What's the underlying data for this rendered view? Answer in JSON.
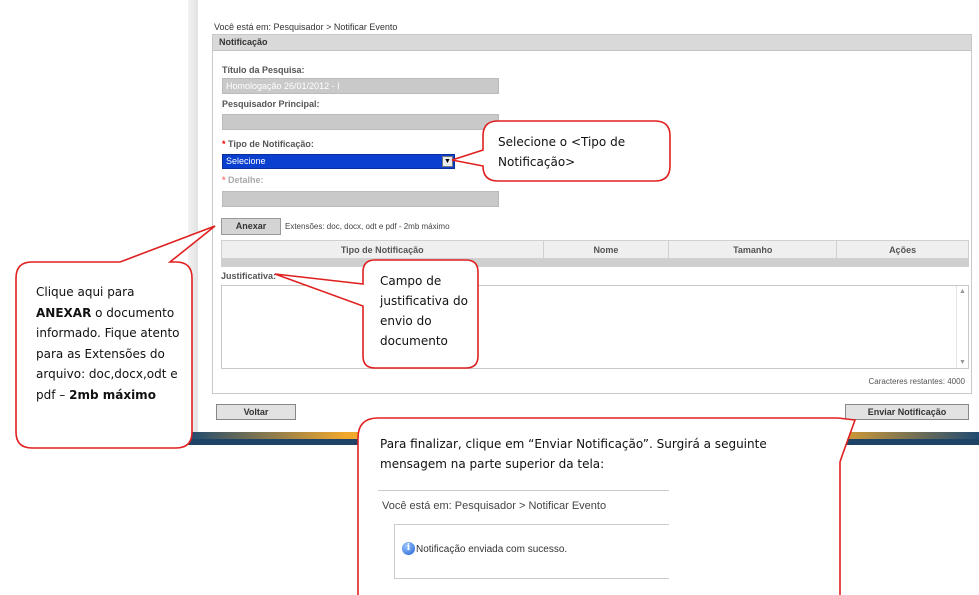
{
  "breadcrumb": "Você está em: Pesquisador > Notificar Evento",
  "panel": {
    "title": "Notificação",
    "titulo_label": "Título da Pesquisa:",
    "titulo_value": "Homologação 26/01/2012 - I",
    "pesquisador_label": "Pesquisador Principal:",
    "pesquisador_value": "",
    "tipo_label": "Tipo de Notificação:",
    "tipo_selected": "Selecione",
    "detalhe_label": "Detalhe:",
    "detalhe_value": "",
    "required_mark": "*"
  },
  "attach": {
    "button": "Anexar",
    "extensions": "Extensões: doc, docx, odt e pdf - 2mb máximo"
  },
  "table": {
    "columns": [
      "Tipo de Notificação",
      "Nome",
      "Tamanho",
      "Ações"
    ]
  },
  "justificativa": {
    "label": "Justificativa:",
    "value": "",
    "chars_left": "Caracteres restantes: 4000"
  },
  "buttons": {
    "voltar": "Voltar",
    "enviar": "Enviar Notificação"
  },
  "callouts": {
    "tipo": "Selecione o <Tipo de Notificação>",
    "anexar_pre": "Clique aqui para",
    "anexar_bold": "ANEXAR",
    "anexar_post": "o documento informado. Fique atento para as Extensões do arquivo: doc,docx,odt e pdf –",
    "anexar_bold2": "2mb máximo",
    "justificativa": "Campo de justificativa do envio do documento",
    "finalizar": "Para finalizar, clique em “Enviar Notificação”. Surgirá a seguinte mensagem na parte superior da tela:"
  },
  "success_preview": {
    "breadcrumb": "Você está em: Pesquisador > Notificar Evento",
    "message": "Notificação enviada com sucesso."
  },
  "colors": {
    "callout_border": "#e02020",
    "select_bg": "#0a3fd0"
  },
  "icons": {
    "select_arrow": "chevron-down-icon",
    "scroll_up": "scroll-up-arrow-icon",
    "scroll_down": "scroll-down-arrow-icon",
    "info": "info-icon"
  }
}
